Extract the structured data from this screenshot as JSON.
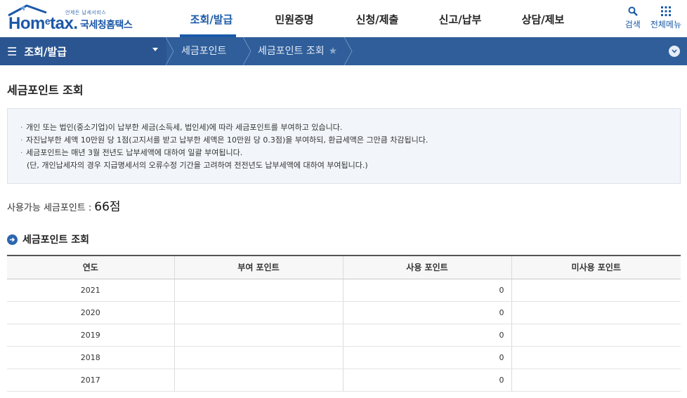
{
  "logo": {
    "tagline": "언제든 납세서비스",
    "brand_main": "Hom",
    "brand_e": "e",
    "brand_tail": "tax.",
    "brand_kr": "국세청홈택스"
  },
  "gnb": [
    {
      "label": "조회/발급",
      "active": true
    },
    {
      "label": "민원증명",
      "active": false
    },
    {
      "label": "신청/제출",
      "active": false
    },
    {
      "label": "신고/납부",
      "active": false
    },
    {
      "label": "상담/제보",
      "active": false
    }
  ],
  "util": {
    "search": "검색",
    "all_menu": "전체메뉴"
  },
  "breadcrumb": {
    "menu": "조회/발급",
    "level1": "세금포인트",
    "level2": "세금포인트 조회"
  },
  "page_title": "세금포인트 조회",
  "notice": [
    "개인 또는 법인(중소기업)이 납부한 세금(소득세, 법인세)에 따라 세금포인트를 부여하고 있습니다.",
    "자진납부한 세액 10만원 당 1점(고지서를 받고 납부한 세액은 10만원 당 0.3점)을 부여하되, 환급세액은 그만큼 차감됩니다.",
    "세금포인트는 매년 3월 전년도 납부세액에 대하여 일괄 부여됩니다.",
    "(단, 개인납세자의 경우 지급명세서의 오류수정 기간을 고려하여 전전년도 납부세액에 대하여 부여됩니다.)"
  ],
  "available": {
    "label": "사용가능 세금포인트 :",
    "value": "66점"
  },
  "section_title": "세금포인트 조회",
  "table": {
    "headers": [
      "연도",
      "부여 포인트",
      "사용 포인트",
      "미사용 포인트"
    ],
    "rows": [
      [
        "2021",
        "",
        "0",
        ""
      ],
      [
        "2020",
        "",
        "0",
        ""
      ],
      [
        "2019",
        "",
        "0",
        ""
      ],
      [
        "2018",
        "",
        "0",
        ""
      ],
      [
        "2017",
        "",
        "0",
        ""
      ]
    ]
  },
  "colors": {
    "brand": "#1c58a8",
    "bar": "#2f5e9a",
    "bar_dark": "#2a5590"
  },
  "icons": {
    "search": "search-icon",
    "menu": "grid-icon",
    "hamburger": "hamburger-icon",
    "star": "star-icon",
    "toggle": "chevron-down-icon",
    "section": "arrow-circle-icon"
  }
}
